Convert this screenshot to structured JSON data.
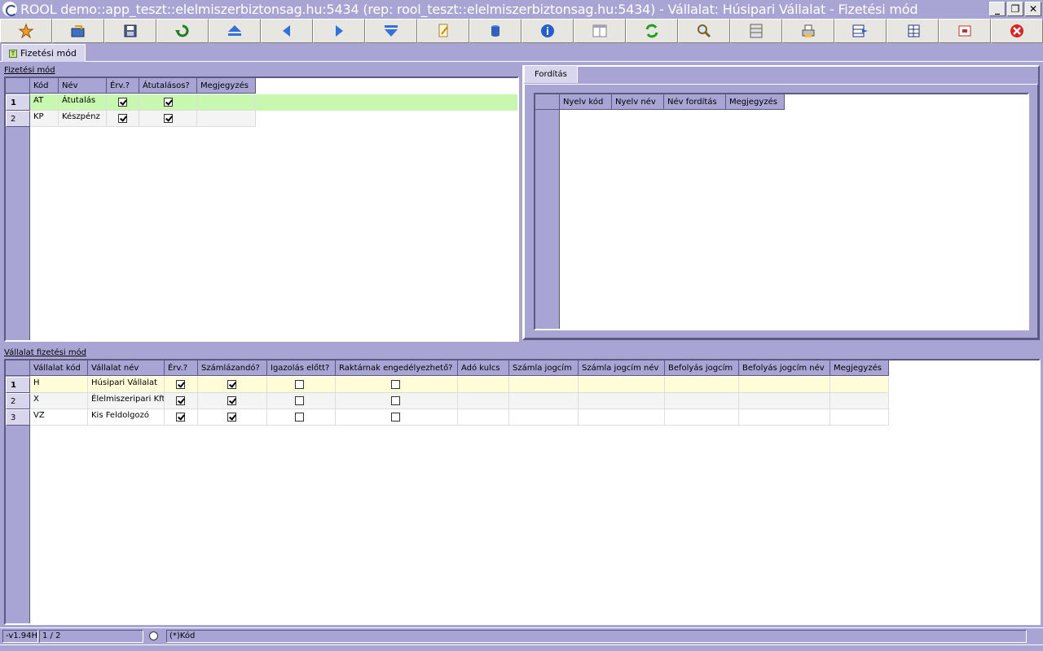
{
  "window": {
    "title": "ROOL demo::app_teszt::elelmiszerbiztonsag.hu:5434 (rep: rool_teszt::elelmiszerbiztonsag.hu:5434) - Vállalat: Húsipari Vállalat - Fizetési mód",
    "controls": [
      "_",
      "❐",
      "✕"
    ]
  },
  "toolbar": {
    "buttons": [
      "new-icon",
      "open-icon",
      "save-icon",
      "undo-icon",
      "first-record-icon",
      "previous-record-icon",
      "next-record-icon",
      "last-record-icon",
      "edit-icon",
      "database-icon",
      "info-icon",
      "layout-icon",
      "refresh-icon",
      "search-icon",
      "columns-icon",
      "print-icon",
      "grid-export-icon",
      "grid-import-icon",
      "fullscreen-icon",
      "close-icon"
    ]
  },
  "main_tab": {
    "label": "Fizetési mód",
    "icon": "T"
  },
  "fizetesi_mod": {
    "label": "Fizetési mód",
    "columns": [
      "Kód",
      "Név",
      "Érv.?",
      "Átutalásos?",
      "Megjegyzés"
    ],
    "rows": [
      {
        "num": "1",
        "kod": "AT",
        "nev": "Átutalás",
        "erv": true,
        "atutalasos": true,
        "megjegyzes": ""
      },
      {
        "num": "2",
        "kod": "KP",
        "nev": "Készpénz",
        "erv": true,
        "atutalasos": true,
        "megjegyzes": ""
      }
    ]
  },
  "forditas": {
    "tab_label": "Fordítás",
    "columns": [
      "Nyelv kód",
      "Nyelv név",
      "Név fordítás",
      "Megjegyzés"
    ]
  },
  "vallalat_fizetesi_mod": {
    "label": "Vállalat fizetési mód",
    "columns": [
      "Vállalat kód",
      "Vállalat név",
      "Érv.?",
      "Számlázandó?",
      "Igazolás előtt?",
      "Raktárnak engedélyezhető?",
      "Adó kulcs",
      "Számla jogcím",
      "Számla jogcím név",
      "Befolyás jogcím",
      "Befolyás jogcím név",
      "Megjegyzés"
    ],
    "rows": [
      {
        "num": "1",
        "kod": "H",
        "nev": "Húsipari Vállalat",
        "erv": true,
        "szamlazando": true,
        "igazolas": false,
        "raktar": false
      },
      {
        "num": "2",
        "kod": "X",
        "nev": "Élelmiszeripari Kft.",
        "erv": true,
        "szamlazando": true,
        "igazolas": false,
        "raktar": false
      },
      {
        "num": "3",
        "kod": "VZ",
        "nev": "Kis Feldolgozó",
        "erv": true,
        "szamlazando": true,
        "igazolas": false,
        "raktar": false
      }
    ]
  },
  "status": {
    "version": "-v1.94H",
    "record": "1 / 2",
    "sort_field": "(*)Kód"
  },
  "colors": {
    "background": "#a8a4d4",
    "selected_row_top": "#c8f8b0",
    "selected_row_bottom": "#fffdd8"
  }
}
